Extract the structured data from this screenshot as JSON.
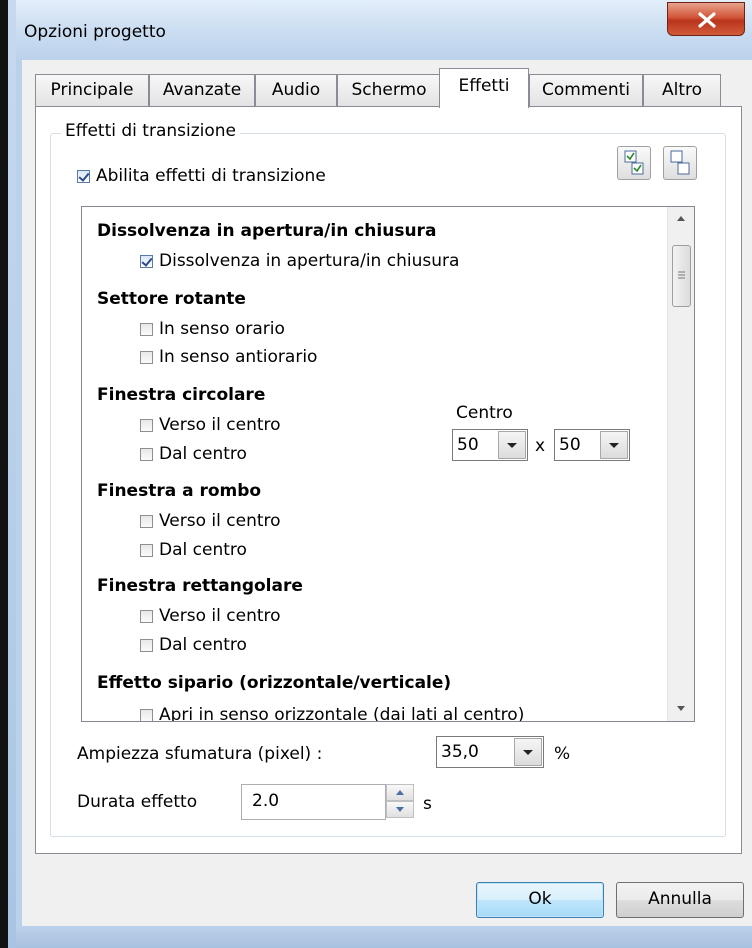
{
  "window": {
    "title": "Opzioni progetto"
  },
  "tabs": [
    "Principale",
    "Avanzate",
    "Audio",
    "Schermo",
    "Effetti",
    "Commenti",
    "Altro"
  ],
  "active_tab": "Effetti",
  "group": {
    "legend": "Effetti di transizione",
    "enable_label": "Abilita effetti di transizione",
    "enable_checked": true
  },
  "list": {
    "sections": [
      {
        "title": "Dissolvenza in apertura/in chiusura",
        "options": [
          {
            "label": "Dissolvenza in apertura/in chiusura",
            "checked": true
          }
        ]
      },
      {
        "title": "Settore rotante",
        "options": [
          {
            "label": "In senso orario",
            "checked": false
          },
          {
            "label": "In senso antiorario",
            "checked": false
          }
        ]
      },
      {
        "title": "Finestra circolare",
        "options": [
          {
            "label": "Verso il centro",
            "checked": false
          },
          {
            "label": "Dal centro",
            "checked": false
          }
        ]
      },
      {
        "title": "Finestra a rombo",
        "options": [
          {
            "label": "Verso il centro",
            "checked": false
          },
          {
            "label": "Dal centro",
            "checked": false
          }
        ]
      },
      {
        "title": "Finestra rettangolare",
        "options": [
          {
            "label": "Verso il centro",
            "checked": false
          },
          {
            "label": "Dal centro",
            "checked": false
          }
        ]
      },
      {
        "title": "Effetto sipario (orizzontale/verticale)",
        "options": [
          {
            "label": "Apri in senso orizzontale (dai lati al centro)",
            "checked": false
          }
        ]
      }
    ],
    "center": {
      "label": "Centro",
      "x": "50",
      "sep": "x",
      "y": "50"
    }
  },
  "feather": {
    "label": "Ampiezza sfumatura (pixel) :",
    "value": "35,0",
    "unit": "%"
  },
  "duration": {
    "label": "Durata effetto",
    "value": "2.0",
    "unit": "s"
  },
  "buttons": {
    "ok": "Ok",
    "cancel": "Annulla"
  },
  "colors": {
    "close_button": "#c9472b",
    "default_button_border": "#3c7fb1"
  },
  "icons": {
    "check_all": "check-all-icon",
    "uncheck_all": "uncheck-all-icon"
  }
}
